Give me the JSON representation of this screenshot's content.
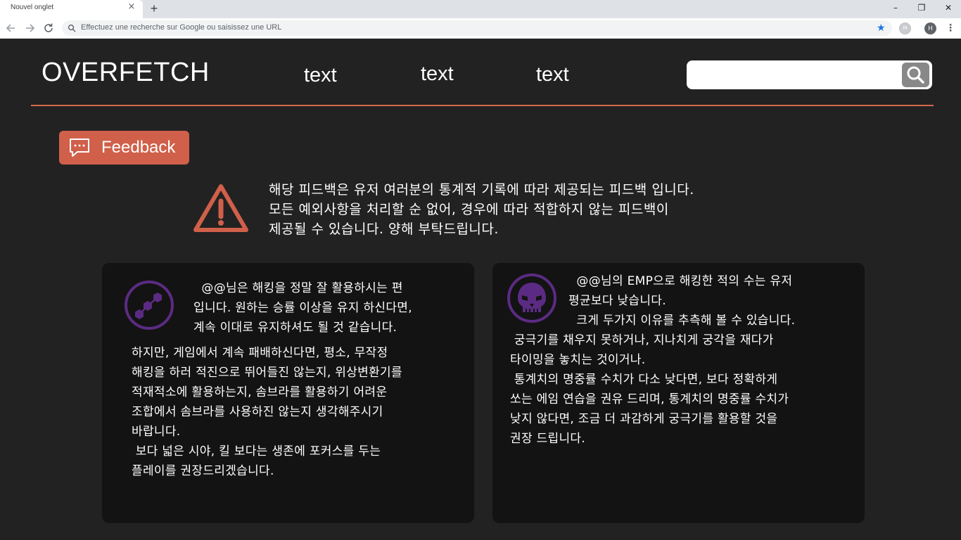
{
  "browser": {
    "tab_title": "Nouvel onglet",
    "tab_close": "×",
    "new_tab": "+",
    "window_controls": {
      "minimize": "–",
      "restore": "❐",
      "close": "✕"
    },
    "omnibox_placeholder": "Effectuez une recherche sur Google ou saisissez une URL",
    "profile_initial": "H",
    "extension_label": "M"
  },
  "header": {
    "logo": "OVERFETCH",
    "nav": [
      "text",
      "text",
      "text"
    ],
    "search_value": ""
  },
  "feedback_button": {
    "label": "Feedback"
  },
  "notice": {
    "lines": [
      "해당 피드백은 유저 여러분의 통계적 기록에 따라 제공되는 피드백 입니다.",
      "모든 예외사항을 처리할 순 없어, 경우에 따라 적합하지 않는 피드백이",
      "제공될 수 있습니다. 양해 부탁드립니다."
    ]
  },
  "cards": [
    {
      "icon": "hacking-hexagon-icon",
      "intro_lines": [
        "  @@님은 해킹을 정말 잘 활용하시는 편",
        "입니다. 원하는 승률 이상을 유지 하신다면,",
        "계속 이대로 유지하셔도 될 것 같습니다."
      ],
      "body_lines": [
        "하지만, 게임에서 계속 패배하신다면, 평소, 무작정",
        "해킹을 하러 적진으로 뛰어들진 않는지, 위상변환기를",
        "적재적소에 활용하는지, 솜브라를 활용하기 어려운",
        "조합에서 솜브라를 사용하진 않는지 생각해주시기",
        "바랍니다.",
        "",
        " 보다 넓은 시야, 킬 보다는 생존에 포커스를 두는",
        "플레이를 권장드리겠습니다."
      ]
    },
    {
      "icon": "skull-emp-icon",
      "intro_lines": [
        "  @@님의 EMP으로 해킹한 적의 수는 유저",
        "평균보다 낮습니다.",
        "  크게 두가지 이유를 추측해 볼 수 있습니다."
      ],
      "body_lines": [
        " 궁극기를 채우지 못하거나, 지나치게 궁각을 재다가",
        "타이밍을 놓치는 것이거나.",
        "",
        " 통계치의 명중률 수치가 다소 낮다면, 보다 정확하게",
        "쏘는 에임 연습을 권유 드리며, 통계치의 명중률 수치가",
        "낮지 않다면, 조금 더 과감하게 궁극기를 활용할 것을",
        "권장 드립니다."
      ]
    }
  ],
  "colors": {
    "page_bg": "#232222",
    "card_bg": "#131313",
    "accent": "#d0604a",
    "icon_purple": "#5b2b83"
  }
}
